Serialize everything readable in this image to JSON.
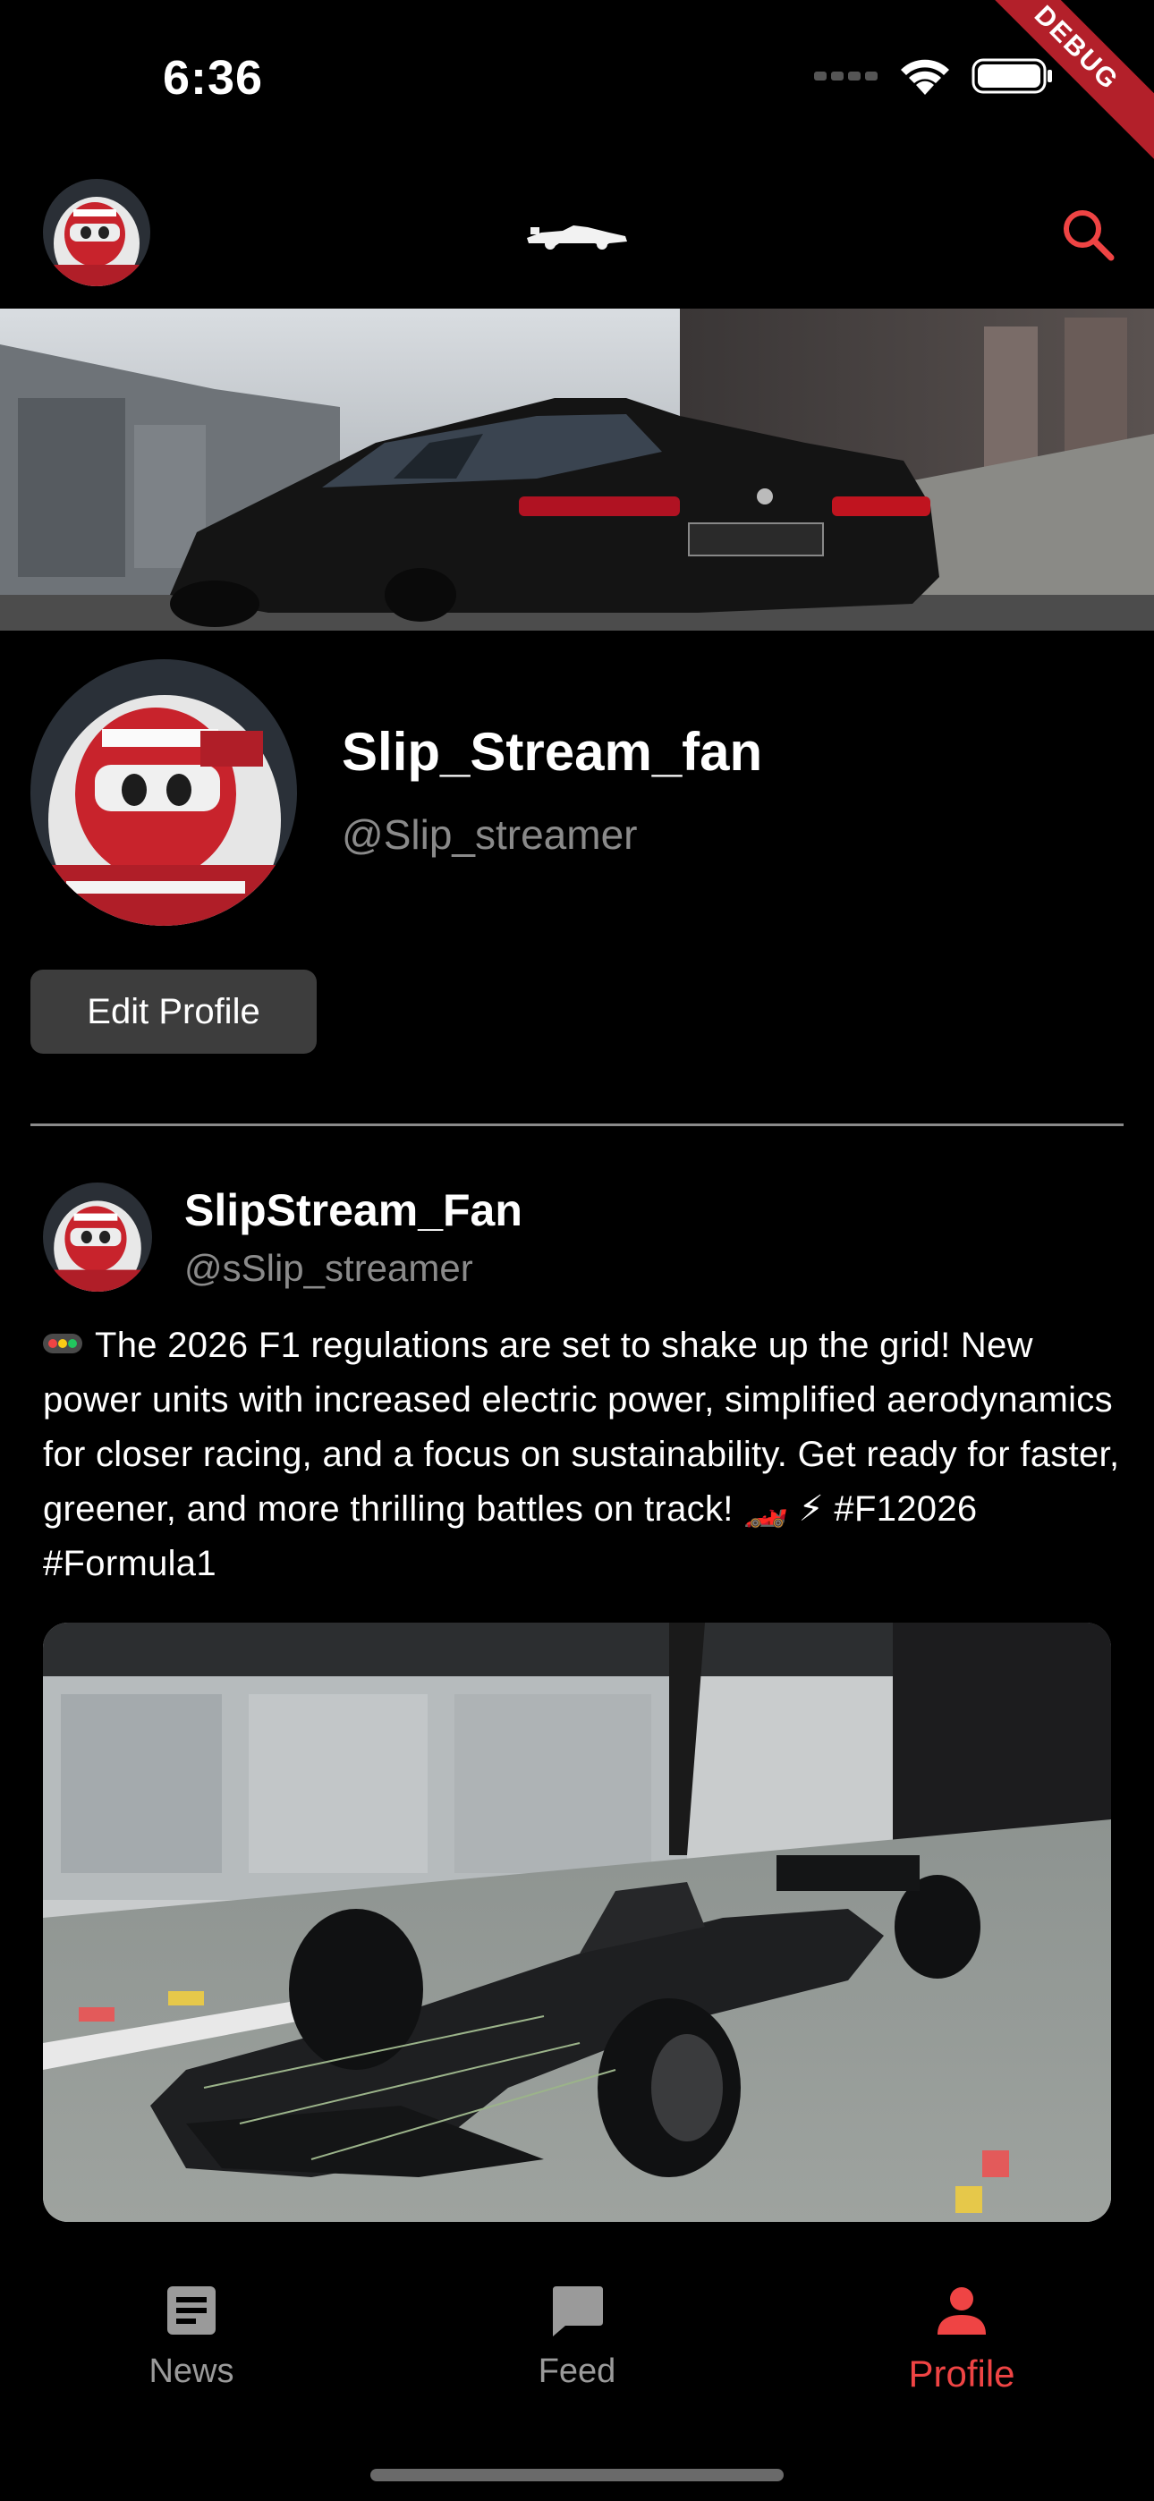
{
  "status_bar": {
    "time": "6:36",
    "debug_label": "DEBUG"
  },
  "app_bar": {
    "logo_icon": "f1-car-icon",
    "search_icon": "search-icon",
    "accent_color": "#ef4444"
  },
  "profile": {
    "display_name": "Slip_Stream_fan",
    "handle": "@Slip_streamer",
    "edit_button_label": "Edit Profile"
  },
  "post": {
    "author": "SlipStream_Fan",
    "handle": "@sSlip_streamer",
    "text_lead_emoji": "🚥",
    "text": "The 2026 F1 regulations are set to shake up the grid! New power units with increased electric power, simplified aerodynamics for closer racing, and a focus on sustainability. Get ready for faster, greener, and more thrilling battles on track! 🏎️ ⚡  #F12026 #Formula1"
  },
  "bottom_nav": {
    "items": [
      {
        "label": "News",
        "icon": "article-icon"
      },
      {
        "label": "Feed",
        "icon": "chat-bubble-icon"
      },
      {
        "label": "Profile",
        "icon": "person-icon"
      }
    ],
    "active": "Profile",
    "active_color": "#ef4444",
    "inactive_color": "#9a9a9a"
  }
}
